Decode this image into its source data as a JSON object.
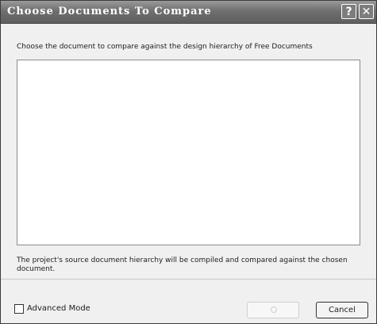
{
  "window": {
    "title": "Choose Documents To Compare",
    "help_glyph": "?",
    "close_glyph": "✕"
  },
  "instruction": "Choose the document to compare against the design hierarchy of Free Documents",
  "document_list": {
    "items": []
  },
  "footnote": "The project's source document hierarchy will be compiled and compared against the chosen document.",
  "advanced_mode": {
    "label": "Advanced Mode",
    "checked": false
  },
  "buttons": {
    "ok_label": "",
    "cancel_label": "Cancel"
  },
  "icons": {
    "help": "help-icon",
    "close": "close-icon"
  }
}
